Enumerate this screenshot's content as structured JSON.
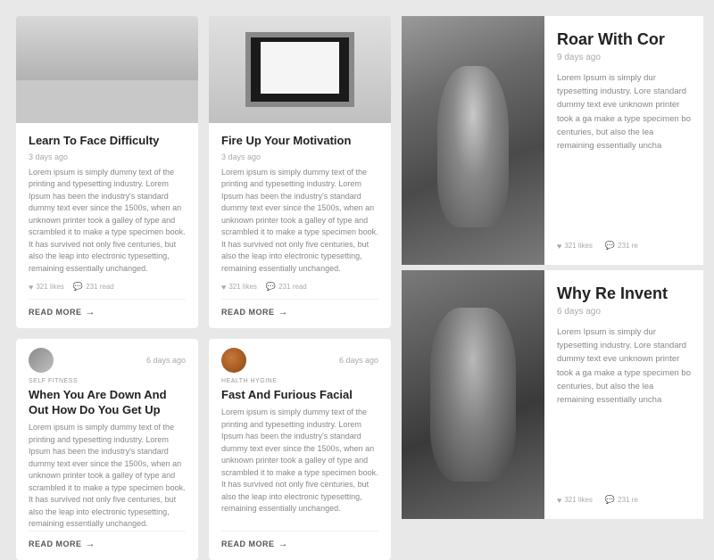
{
  "cards": [
    {
      "id": "card-1",
      "has_image": true,
      "image_type": "desk",
      "title": "Learn To Face Difficulty",
      "date": "3 days ago",
      "tag": "",
      "text": "Lorem ipsum is simply dummy text of the printing and typesetting industry. Lorem Ipsum has been the industry's standard dummy text ever since the 1500s, when an unknown printer took a galley of type and scrambled it to make a type specimen book. It has survived not only five centuries, but also the leap into electronic typesetting, remaining essentially unchanged.",
      "likes": "321 likes",
      "read": "231 read",
      "read_more": "READ MORE"
    },
    {
      "id": "card-2",
      "has_image": true,
      "image_type": "poster",
      "title": "Fire Up Your Motivation",
      "date": "3 days ago",
      "tag": "",
      "text": "Lorem ipsum is simply dummy text of the printing and typesetting industry. Lorem Ipsum has been the industry's standard dummy text ever since the 1500s, when an unknown printer took a galley of type and scrambled it to make a type specimen book. It has survived not only five centuries, but also the leap into electronic typesetting, remaining essentially unchanged.",
      "likes": "321 likes",
      "read": "231 read",
      "read_more": "READ MORE"
    },
    {
      "id": "card-3",
      "has_image": false,
      "image_type": "avatar_desk",
      "title": "When You Are Down And Out How Do You Get Up",
      "date": "6 days ago",
      "tag": "SELF FITNESS",
      "text": "Lorem ipsum is simply dummy text of the printing and typesetting industry. Lorem Ipsum has been the industry's standard dummy text ever since the 1500s, when an unknown printer took a galley of type and scrambled it to make a type specimen book. It has survived not only five centuries, but also the leap into electronic typesetting, remaining essentially unchanged.",
      "likes": "",
      "read": "",
      "read_more": "READ MORE"
    },
    {
      "id": "card-4",
      "has_image": false,
      "image_type": "avatar_orange",
      "title": "Fast And Furious Facial",
      "date": "6 days ago",
      "tag": "HEALTH HYGINE",
      "text": "Lorem ipsum is simply dummy text of the printing and typesetting industry. Lorem Ipsum has been the industry's standard dummy text ever since the 1500s, when an unknown printer took a galley of type and scrambled it to make a type specimen book. It has survived not only five centuries, but also the leap into electronic typesetting, remaining essentially unchanged.",
      "likes": "",
      "read": "",
      "read_more": "READ MORE"
    }
  ],
  "features": [
    {
      "id": "feature-1",
      "image_type": "man",
      "title": "Roar With Cor",
      "date": "9 days ago",
      "text": "Lorem Ipsum is simply dur typesetting industry. Lore standard dummy text eve unknown printer took a ga make a type specimen bo centuries, but also the lea remaining essentially uncha",
      "likes": "321 likes",
      "read": "231 re"
    },
    {
      "id": "feature-2",
      "image_type": "old",
      "title": "Why Re Invent",
      "date": "6 days ago",
      "text": "Lorem Ipsum is simply dur typesetting industry. Lore standard dummy text eve unknown printer took a ga make a type specimen bo centuries, but also the lea remaining essentially uncha",
      "likes": "321 likes",
      "read": "231 re"
    }
  ],
  "labels": {
    "read_more": "READ MORE",
    "arrow": "→",
    "heart": "♥",
    "comment": "💬"
  }
}
